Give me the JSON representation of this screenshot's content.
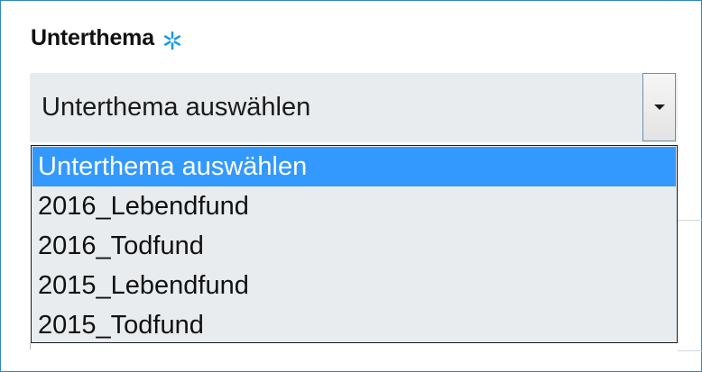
{
  "field": {
    "label": "Unterthema",
    "required_icon": "asterisk-icon",
    "required_color": "#1e9be0"
  },
  "select": {
    "value": "Unterthema auswählen",
    "button_icon": "chevron-down-icon"
  },
  "dropdown": {
    "options": [
      {
        "label": "Unterthema auswählen",
        "selected": true
      },
      {
        "label": "2016_Lebendfund",
        "selected": false
      },
      {
        "label": "2016_Todfund",
        "selected": false
      },
      {
        "label": "2015_Lebendfund",
        "selected": false
      },
      {
        "label": "2015_Todfund",
        "selected": false
      }
    ],
    "highlight_color": "#3399ff"
  }
}
